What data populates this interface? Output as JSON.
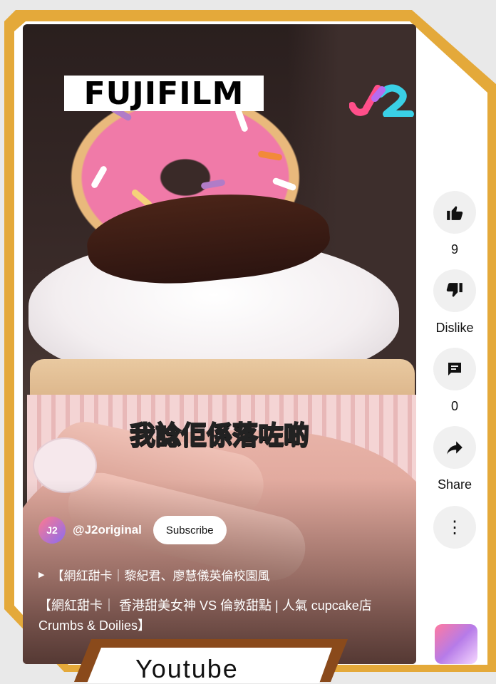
{
  "video": {
    "brand_logo_text": "FUJIFILM",
    "caption": "我諗佢係落咗啲",
    "channel": {
      "handle": "@J2original",
      "subscribe_label": "Subscribe"
    },
    "playlist_text": "【網紅甜卡｜黎紀君、廖慧儀英倫校園風",
    "description": "【網紅甜卡｜ 香港甜美女神 VS 倫敦甜點 | 人氣 cupcake店Crumbs & Doilies】"
  },
  "actions": {
    "like_count": "9",
    "dislike_label": "Dislike",
    "comment_count": "0",
    "share_label": "Share"
  },
  "banner": {
    "text": "Youtube"
  },
  "colors": {
    "frame": "#e4a93a",
    "banner_border": "#8a4a1b"
  }
}
